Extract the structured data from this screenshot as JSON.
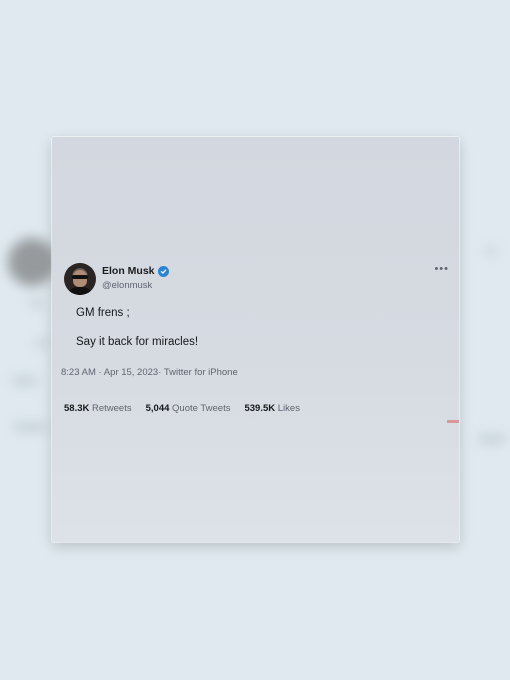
{
  "tweet": {
    "author_name": "Elon Musk",
    "handle": "@elonmusk",
    "text_lines": [
      "GM frens ;",
      "Say it back for miracles!"
    ],
    "time": "8:23 AM",
    "date": "Apr 15, 2023",
    "source": "Twitter for iPhone",
    "more_label": "•••",
    "verified": true,
    "stats": {
      "retweets_count": "58.3K",
      "retweets_label": "Retweets",
      "quotes_count": "5,044",
      "quotes_label": "Quote Tweets",
      "likes_count": "539.5K",
      "likes_label": "Likes"
    }
  },
  "colors": {
    "background": "#dfe9ef",
    "card": "#d6dbe2",
    "verified_badge": "#2a84d6",
    "text_primary": "#16171b",
    "text_secondary": "#5e6570"
  },
  "icons": {
    "verified": "verified-check-icon",
    "more": "more-options-icon"
  }
}
